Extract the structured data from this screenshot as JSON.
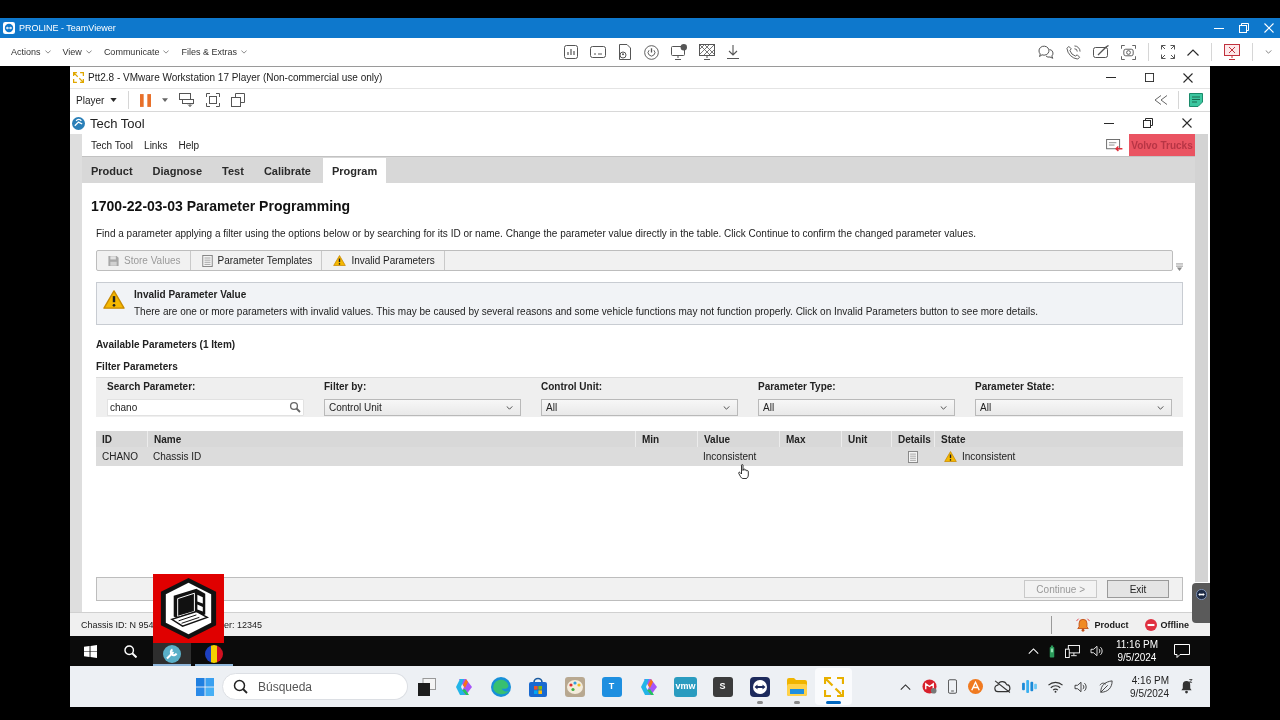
{
  "teamviewer": {
    "title": "PROLINE - TeamViewer",
    "menus": [
      {
        "label": "Actions"
      },
      {
        "label": "View"
      },
      {
        "label": "Communicate"
      },
      {
        "label": "Files & Extras"
      }
    ]
  },
  "vmware": {
    "title": "Ptt2.8 - VMware Workstation 17 Player (Non-commercial use only)",
    "player_menu": "Player"
  },
  "tech_tool": {
    "title": "Tech Tool",
    "menu": [
      {
        "label": "Tech Tool"
      },
      {
        "label": "Links"
      },
      {
        "label": "Help"
      }
    ],
    "brand_button": "Volvo Trucks",
    "tabs": [
      {
        "label": "Product",
        "selected": false
      },
      {
        "label": "Diagnose",
        "selected": false
      },
      {
        "label": "Test",
        "selected": false
      },
      {
        "label": "Calibrate",
        "selected": false
      },
      {
        "label": "Program",
        "selected": true
      }
    ],
    "heading": "1700-22-03-03 Parameter Programming",
    "description": "Find a parameter applying a filter using the options below or by searching for its ID or name. Change the parameter value directly in the table. Click Continue to confirm the changed parameter values.",
    "toolbar": [
      {
        "kind": "save",
        "label": "Store Values",
        "disabled": true
      },
      {
        "kind": "templates",
        "label": "Parameter Templates",
        "disabled": false
      },
      {
        "kind": "warning",
        "label": "Invalid Parameters",
        "disabled": false
      }
    ],
    "alert": {
      "kind": "warning",
      "title": "Invalid Parameter Value",
      "message": "There are one or more parameters with invalid values. This may be caused by several reasons and some vehicle functions may not function properly. Click on Invalid Parameters button to see more details."
    },
    "available_heading": "Available Parameters (1 Item)",
    "filter_heading": "Filter Parameters",
    "filters": [
      {
        "kind": "search",
        "label": "Search Parameter:",
        "value": "chano"
      },
      {
        "kind": "select",
        "label": "Filter by:",
        "value": "Control Unit"
      },
      {
        "kind": "select",
        "label": "Control Unit:",
        "value": "All"
      },
      {
        "kind": "select",
        "label": "Parameter Type:",
        "value": "All"
      },
      {
        "kind": "select",
        "label": "Parameter State:",
        "value": "All"
      }
    ],
    "table": {
      "columns": [
        "ID",
        "Name",
        "Min",
        "Value",
        "Max",
        "Unit",
        "Details",
        "State"
      ],
      "rows": [
        {
          "id": "CHANO",
          "name": "Chassis ID",
          "value": "Inconsistent",
          "has_details": true,
          "state": {
            "kind": "warning",
            "text": "Inconsistent"
          },
          "selected": true
        }
      ]
    },
    "actions": [
      {
        "label": "Continue >",
        "disabled": true
      },
      {
        "label": "Exit",
        "disabled": false
      }
    ],
    "status_bar": {
      "chassis_text": "Chassis ID: N 954",
      "serial_text": "er: 12345",
      "product": "Product",
      "connection": "Offline"
    }
  },
  "guest_taskbar": {
    "apps": [
      {
        "kind": "wrench",
        "active": true,
        "running": true
      },
      {
        "kind": "flag",
        "active": false,
        "running": true
      }
    ],
    "time": "11:16 PM",
    "date": "9/5/2024"
  },
  "host_taskbar": {
    "search_placeholder": "Búsqueda",
    "apps": [
      {
        "kind": "taskview",
        "active": false,
        "running": false
      },
      {
        "kind": "copilot",
        "active": false,
        "running": false
      },
      {
        "kind": "edge",
        "active": false,
        "running": false
      },
      {
        "kind": "store",
        "active": false,
        "running": false
      },
      {
        "kind": "paint",
        "active": false,
        "running": false
      },
      {
        "kind": "tile",
        "glyph": "T",
        "color": "#1e8fe0",
        "active": false,
        "running": false
      },
      {
        "kind": "copilot",
        "active": false,
        "running": false
      },
      {
        "kind": "tile",
        "glyph": "vmw",
        "color": "#2a9cc0",
        "active": false,
        "running": false
      },
      {
        "kind": "tile",
        "glyph": "S",
        "color": "#3c3c3c",
        "active": false,
        "running": false
      },
      {
        "kind": "teamviewer",
        "active": false,
        "running": true
      },
      {
        "kind": "folder",
        "active": false,
        "running": true
      },
      {
        "kind": "vmware",
        "active": true,
        "running": true
      }
    ],
    "time": "4:16 PM",
    "date": "9/5/2024"
  }
}
